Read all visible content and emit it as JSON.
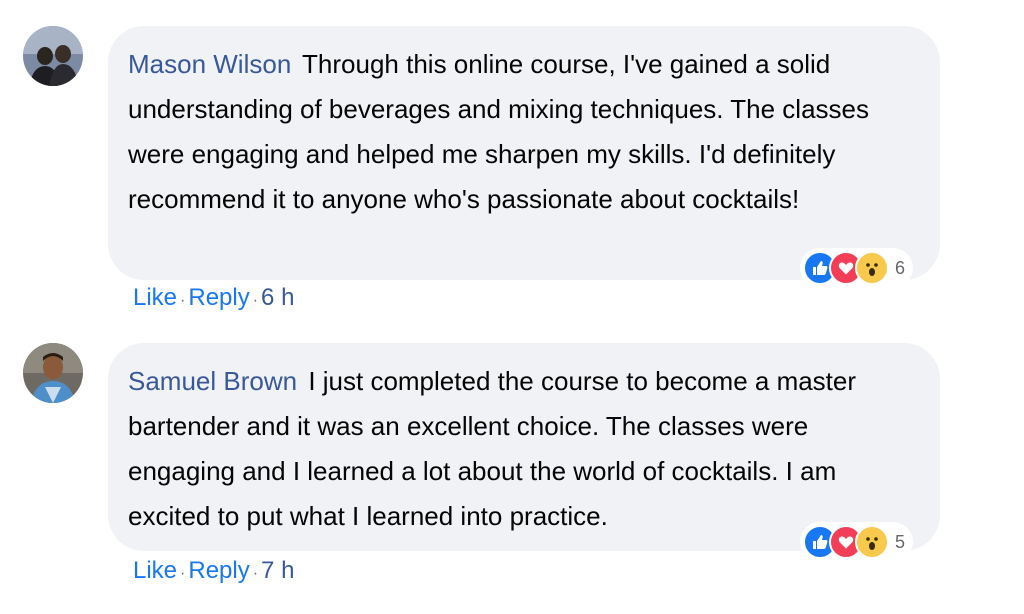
{
  "comments": [
    {
      "author": "Mason Wilson",
      "text": "Through this online course, I've gained a solid understanding of beverages and mixing techniques. The classes were engaging and helped me sharpen my skills. I'd definitely recommend it to anyone who's passionate about cocktails!",
      "reaction_count": "6",
      "reactions": [
        "like",
        "love",
        "wow"
      ],
      "like_label": "Like",
      "reply_label": "Reply",
      "separator": "·",
      "time": "6 h"
    },
    {
      "author": "Samuel Brown",
      "text": "I just completed the course to become a master bartender and it was an excellent choice. The classes were engaging and I learned a lot about the world of cocktails. I am excited to put what I learned into practice.",
      "reaction_count": "5",
      "reactions": [
        "like",
        "love",
        "wow"
      ],
      "like_label": "Like",
      "reply_label": "Reply",
      "separator": "·",
      "time": "7 h"
    }
  ],
  "colors": {
    "author": "#385898",
    "bubble": "#f0f2f5",
    "link": "#1877f2",
    "like": "#1877f2",
    "love": "#f33e58",
    "wow": "#f7c94c"
  }
}
